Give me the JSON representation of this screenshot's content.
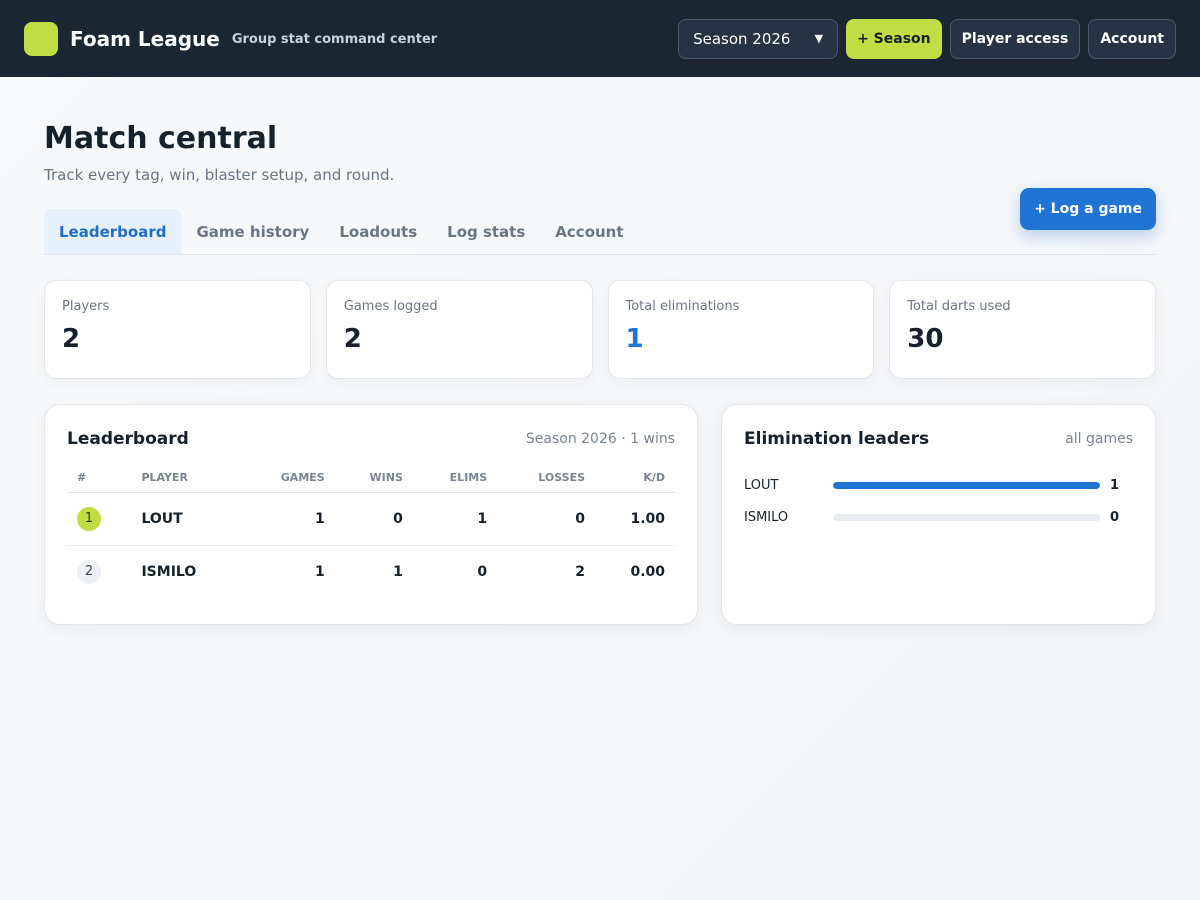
{
  "header": {
    "brand_name": "Foam League",
    "tagline": "Group stat command center",
    "season_select": "Season 2026",
    "add_season_label": "+ Season",
    "player_access_label": "Player access",
    "account_label": "Account"
  },
  "page": {
    "title": "Match central",
    "subtitle": "Track every tag, win, blaster setup, and round.",
    "log_game_label": "+ Log a game"
  },
  "tabs": [
    {
      "label": "Leaderboard",
      "active": true
    },
    {
      "label": "Game history",
      "active": false
    },
    {
      "label": "Loadouts",
      "active": false
    },
    {
      "label": "Log stats",
      "active": false
    },
    {
      "label": "Account",
      "active": false
    }
  ],
  "stats": [
    {
      "label": "Players",
      "value": "2"
    },
    {
      "label": "Games logged",
      "value": "2"
    },
    {
      "label": "Total eliminations",
      "value": "1"
    },
    {
      "label": "Total darts used",
      "value": "30"
    }
  ],
  "leaderboard": {
    "title": "Leaderboard",
    "meta": "Season 2026 · 1 wins",
    "columns": [
      "#",
      "PLAYER",
      "GAMES",
      "WINS",
      "ELIMS",
      "LOSSES",
      "K/D"
    ],
    "rows": [
      {
        "rank": "1",
        "player": "LOUT",
        "games": "1",
        "wins": "0",
        "elims": "1",
        "losses": "0",
        "kd": "1.00"
      },
      {
        "rank": "2",
        "player": "ISMILO",
        "games": "1",
        "wins": "1",
        "elims": "0",
        "losses": "2",
        "kd": "0.00"
      }
    ]
  },
  "elim_leaders": {
    "title": "Elimination leaders",
    "meta": "all games",
    "items": [
      {
        "name": "LOUT",
        "value": "1",
        "fraction": 1.0
      },
      {
        "name": "ISMILO",
        "value": "0",
        "fraction": 0.0
      }
    ]
  },
  "colors": {
    "accent_lime": "#c1dd43",
    "accent_blue": "#1f74d4",
    "topbar": "#1c2632"
  }
}
